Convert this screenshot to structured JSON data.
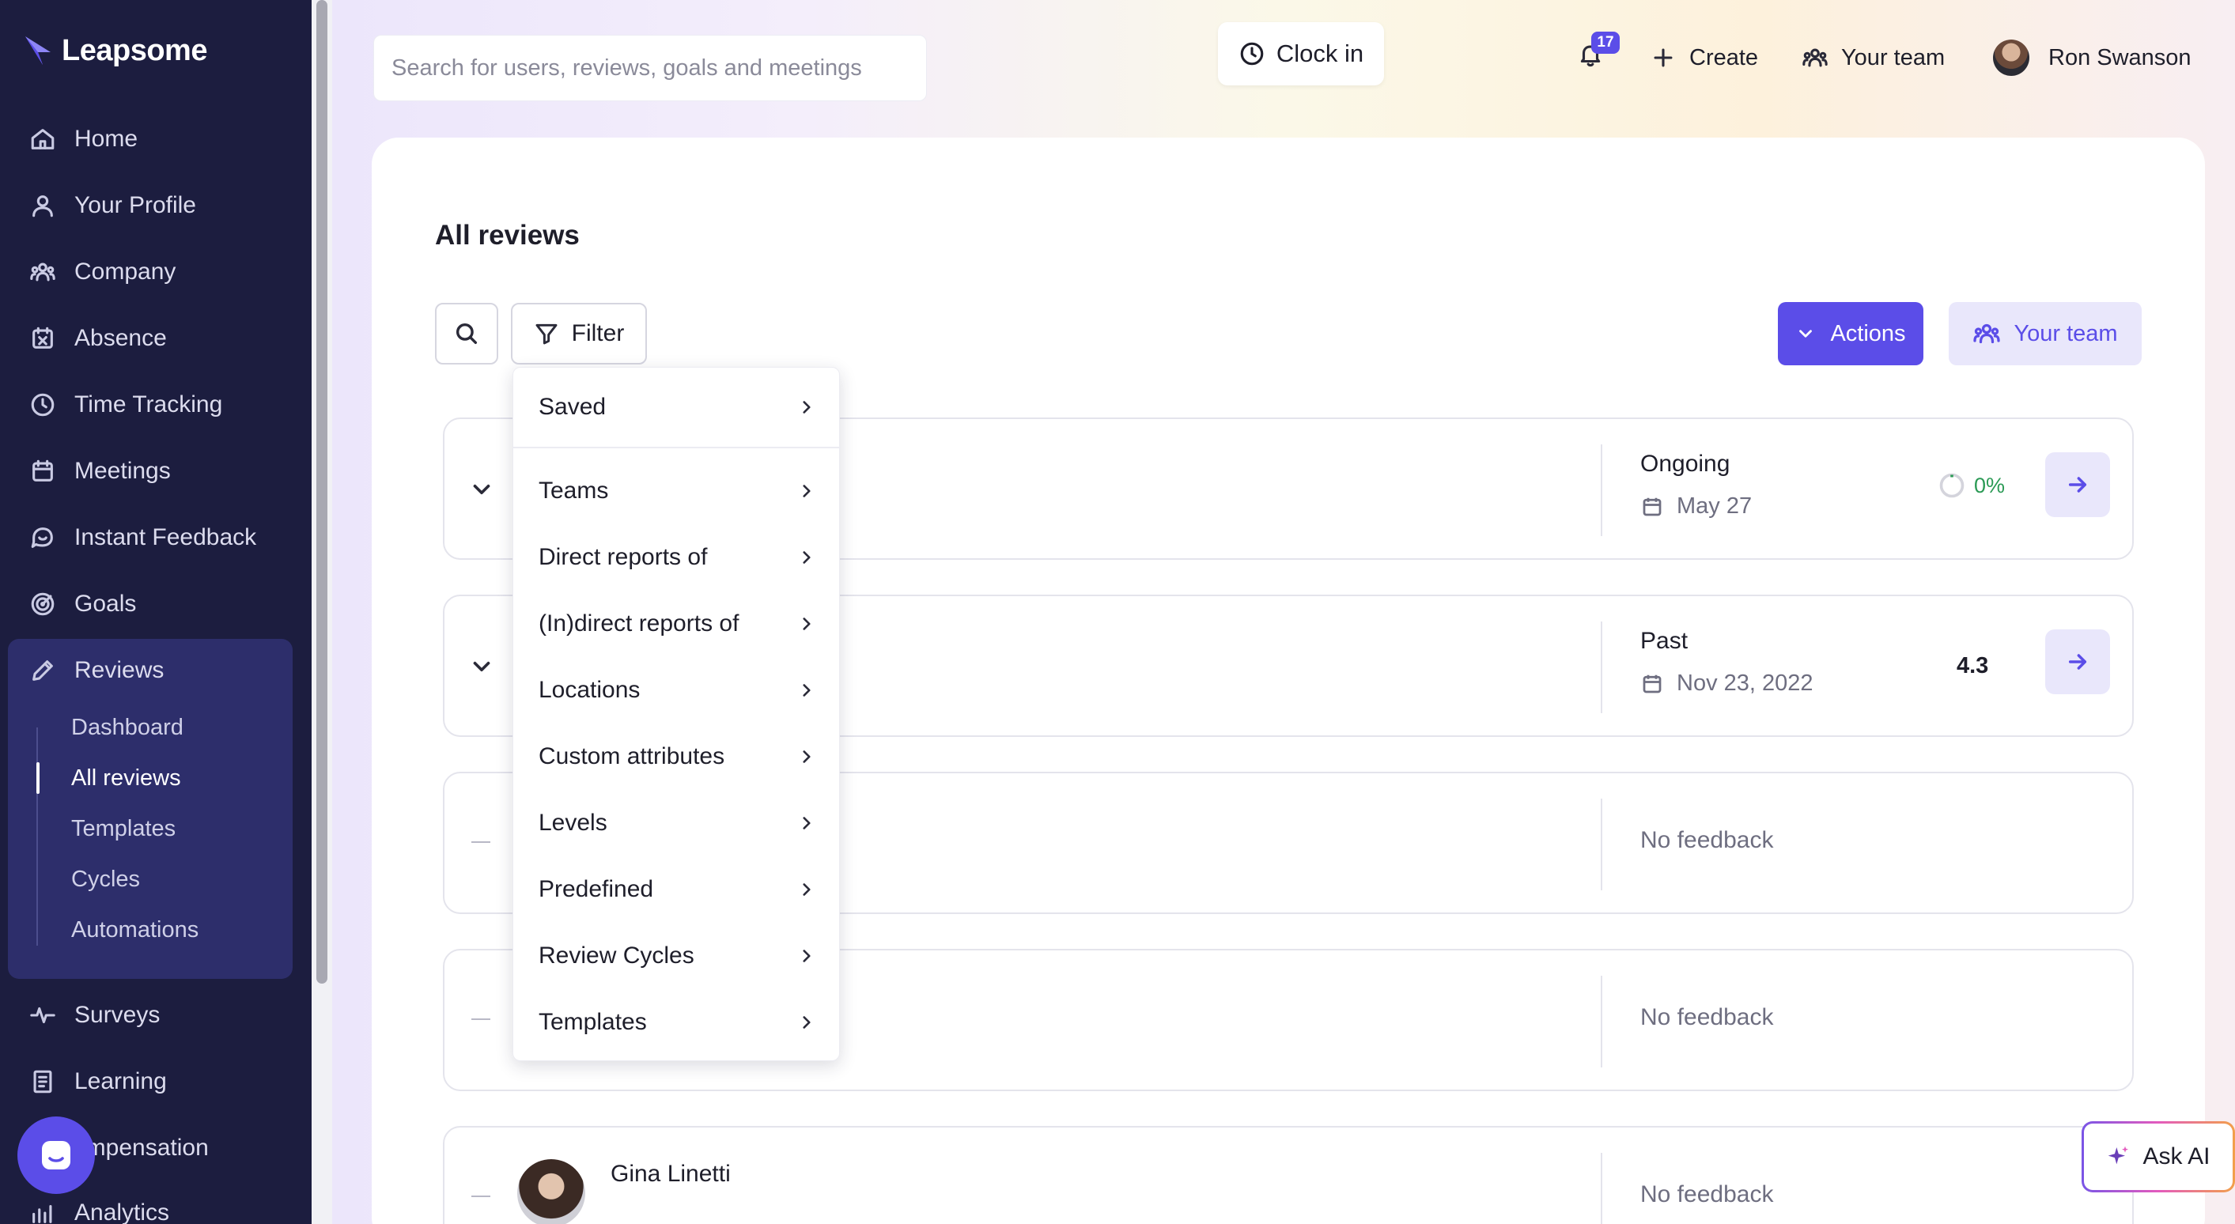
{
  "brand": {
    "name": "Leapsome",
    "accent": "#5b4de8",
    "sidebar_bg": "#1c1d3f"
  },
  "sidebar": {
    "items": [
      {
        "label": "Home",
        "icon": "home-icon"
      },
      {
        "label": "Your Profile",
        "icon": "user-icon"
      },
      {
        "label": "Company",
        "icon": "company-icon"
      },
      {
        "label": "Absence",
        "icon": "absence-icon"
      },
      {
        "label": "Time Tracking",
        "icon": "clock-icon"
      },
      {
        "label": "Meetings",
        "icon": "calendar-icon"
      },
      {
        "label": "Instant Feedback",
        "icon": "chat-icon"
      },
      {
        "label": "Goals",
        "icon": "target-icon"
      },
      {
        "label": "Reviews",
        "icon": "pencil-icon"
      },
      {
        "label": "Surveys",
        "icon": "pulse-icon"
      },
      {
        "label": "Learning",
        "icon": "book-icon"
      },
      {
        "label": "ompensation",
        "icon": "money-icon"
      },
      {
        "label": "Analytics",
        "icon": "chart-icon"
      }
    ],
    "reviews_sub": [
      {
        "label": "Dashboard"
      },
      {
        "label": "All reviews",
        "active": true
      },
      {
        "label": "Templates"
      },
      {
        "label": "Cycles"
      },
      {
        "label": "Automations"
      }
    ]
  },
  "topbar": {
    "search_placeholder": "Search for users, reviews, goals and meetings",
    "clock_in": "Clock in",
    "notification_count": "17",
    "create": "Create",
    "your_team": "Your team",
    "user_name": "Ron Swanson"
  },
  "main": {
    "title": "All reviews",
    "filter_label": "Filter",
    "actions_label": "Actions",
    "your_team_label": "Your team",
    "rows": [
      {
        "status": "Ongoing",
        "date": "May 27",
        "progress": "0%"
      },
      {
        "status": "Past",
        "date": "Nov 23, 2022",
        "score": "4.3"
      },
      {
        "status_text": "No feedback"
      },
      {
        "status_text": "No feedback"
      },
      {
        "name": "Gina Linetti",
        "status_text": "No feedback"
      }
    ]
  },
  "filter_menu": {
    "items": [
      "Saved",
      "Teams",
      "Direct reports of",
      "(In)direct reports of",
      "Locations",
      "Custom attributes",
      "Levels",
      "Predefined",
      "Review Cycles",
      "Templates"
    ]
  },
  "ask_ai": "Ask AI"
}
